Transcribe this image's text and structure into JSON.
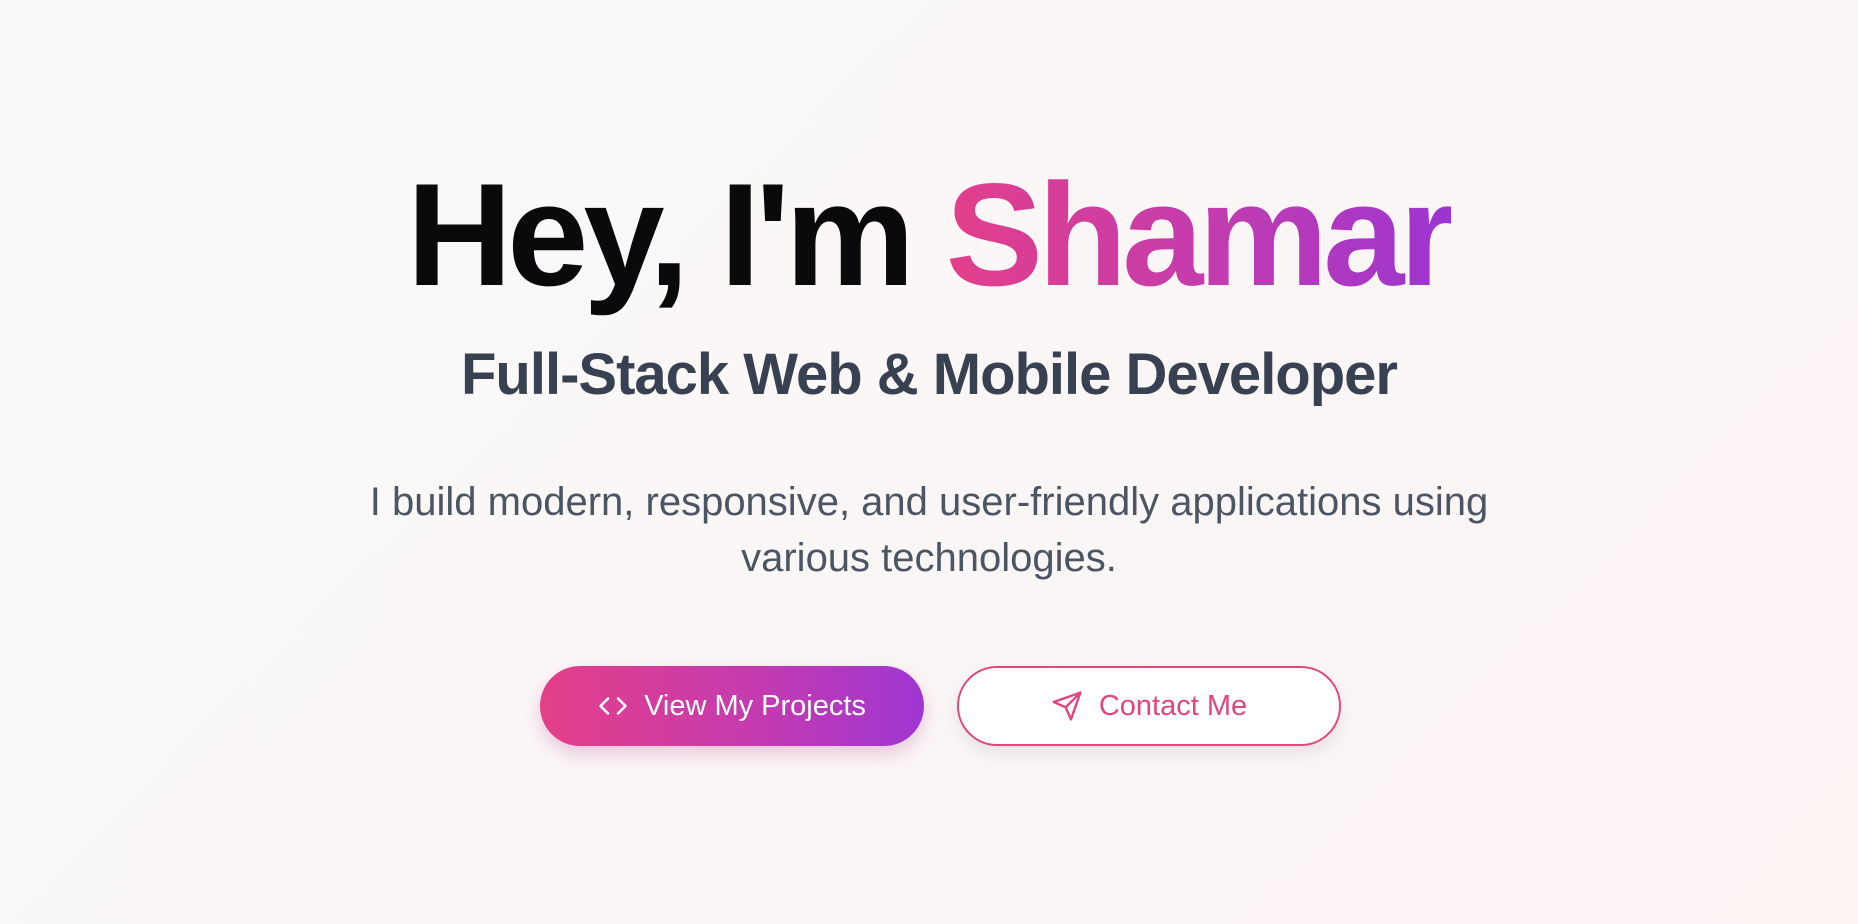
{
  "hero": {
    "greeting": "Hey, I'm",
    "name": "Shamar",
    "subtitle": "Full-Stack Web & Mobile Developer",
    "description": "I build modern, responsive, and user-friendly applications using various technologies."
  },
  "buttons": {
    "primary": {
      "label": "View My Projects",
      "icon": "code-icon"
    },
    "secondary": {
      "label": "Contact Me",
      "icon": "send-icon"
    }
  },
  "colors": {
    "accent_start": "#e33f8a",
    "accent_end": "#9b35d1",
    "heading": "#0a0a0c",
    "subtitle": "#374151",
    "body_text": "#4b5563",
    "outline_accent": "#e2467f"
  }
}
